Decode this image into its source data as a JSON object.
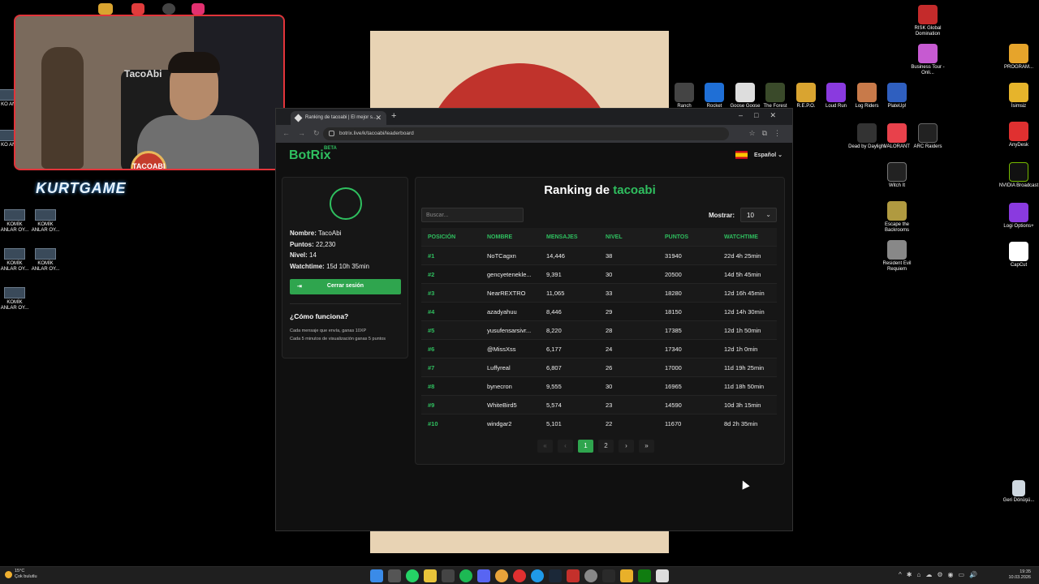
{
  "desktop": {
    "left_icons": [
      {
        "label": "KOMİK ANLAR OY..."
      },
      {
        "label": "KOMİK ANLAR OY..."
      },
      {
        "label": "KOMİK ANLAR OY..."
      },
      {
        "label": "KOMİK ANLAR OY..."
      },
      {
        "label": "KOMİK ANLAR OY..."
      }
    ],
    "top_games": [
      {
        "label": "Ranch"
      },
      {
        "label": "Rocket"
      },
      {
        "label": "Goose Goose"
      },
      {
        "label": "The Forest"
      },
      {
        "label": "R.E.P.O."
      },
      {
        "label": "Loud Run"
      },
      {
        "label": "Log Riders"
      },
      {
        "label": "PlateUp!"
      }
    ],
    "right_col1": [
      {
        "label": "RISK Global Domination"
      },
      {
        "label": "Business Tour - Onli..."
      },
      {
        "label": "Dead by Daylight"
      },
      {
        "label": "VALORANT"
      },
      {
        "label": "ARC Raiders"
      },
      {
        "label": "Witch It"
      },
      {
        "label": "Escape the Backrooms"
      },
      {
        "label": "Resident Evil Requiem"
      }
    ],
    "right_col2": [
      {
        "label": "PROGRAM..."
      },
      {
        "label": "İsimsiz"
      },
      {
        "label": "AnyDesk"
      },
      {
        "label": "NVIDIA Broadcast"
      },
      {
        "label": "Logi Options+"
      },
      {
        "label": "CapCut"
      },
      {
        "label": "Geri Dönüşü..."
      }
    ],
    "webcam": {
      "chair_text": "TacoAbi",
      "badge_text": "TACOABI"
    },
    "overlay_logo": "KURTGAME"
  },
  "browser": {
    "tab_title": "Ranking de tacoabi | El mejor s...",
    "url": "botrix.live/k/tacoabi/leaderboard"
  },
  "page": {
    "logo": "BotRix",
    "beta": "BETA",
    "language": "Español",
    "profile": {
      "name_label": "Nombre:",
      "name": "TacoAbi",
      "points_label": "Puntos:",
      "points": "22,230",
      "level_label": "Nivel:",
      "level": "14",
      "watch_label": "Watchtime:",
      "watchtime": "15d 10h 35min",
      "logout": "Cerrar sesión",
      "how_title": "¿Cómo funciona?",
      "how_line1": "Cada mensaje que envía, ganas 10XP",
      "how_line2": "Cada 5 minutos de visualización ganas 5 puntos"
    },
    "board": {
      "title_prefix": "Ranking de",
      "title_user": "tacoabi",
      "search_placeholder": "Buscar...",
      "show_label": "Mostrar:",
      "show_value": "10",
      "columns": [
        "POSICIÓN",
        "NOMBRE",
        "MENSAJES",
        "NIVEL",
        "PUNTOS",
        "WATCHTIME"
      ],
      "rows": [
        [
          "#1",
          "NoTCagxn",
          "14,446",
          "38",
          "31940",
          "22d 4h 25min"
        ],
        [
          "#2",
          "gencyetenekle...",
          "9,391",
          "30",
          "20500",
          "14d 5h 45min"
        ],
        [
          "#3",
          "NearREXTRO",
          "11,065",
          "33",
          "18280",
          "12d 16h 45min"
        ],
        [
          "#4",
          "azadyahuu",
          "8,446",
          "29",
          "18150",
          "12d 14h 30min"
        ],
        [
          "#5",
          "yusufensarsivr...",
          "8,220",
          "28",
          "17385",
          "12d 1h 50min"
        ],
        [
          "#6",
          "@MissXss",
          "6,177",
          "24",
          "17340",
          "12d 1h 0min"
        ],
        [
          "#7",
          "Luffyreal",
          "6,807",
          "26",
          "17000",
          "11d 19h 25min"
        ],
        [
          "#8",
          "bynecron",
          "9,555",
          "30",
          "16965",
          "11d 18h 50min"
        ],
        [
          "#9",
          "WhiteBird5",
          "5,574",
          "23",
          "14590",
          "10d 3h 15min"
        ],
        [
          "#10",
          "windgar2",
          "5,101",
          "22",
          "11670",
          "8d 2h 35min"
        ]
      ],
      "pager": {
        "first": "«",
        "prev": "‹",
        "page1": "1",
        "page2": "2",
        "next": "›",
        "last": "»"
      }
    }
  },
  "taskbar": {
    "temp": "15°C",
    "weather": "Çok bulutlu",
    "time": "19:35",
    "date": "10.03.2026"
  },
  "colors": {
    "accent": "#2fbf5f",
    "active_page": "#2fa54e",
    "cam_border": "#e2343a"
  }
}
